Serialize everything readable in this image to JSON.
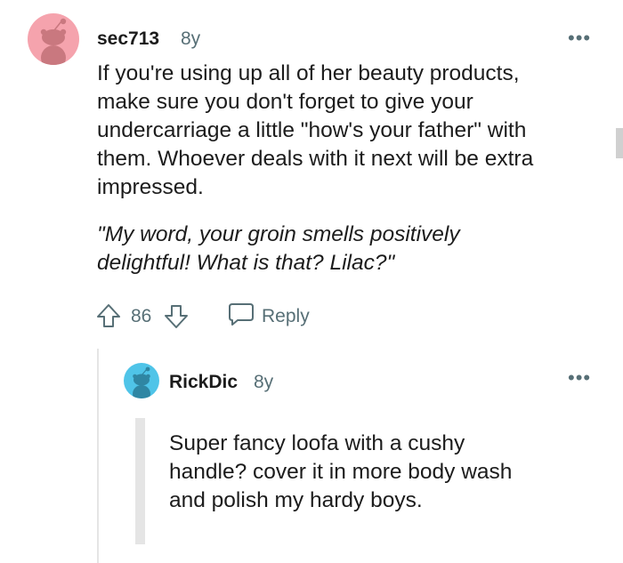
{
  "colors": {
    "avatar_1_bg": "#f5a3ad",
    "avatar_2_bg": "#4fc4e8",
    "meta_text": "#576f76",
    "thread_line": "#e5e5e5"
  },
  "comment": {
    "username": "sec713",
    "age": "8y",
    "more": "•••",
    "body_lines": [
      "If you're using up all of her beauty products,",
      "make sure you don't forget to give your",
      "undercarriage a little \"how's your father\" with",
      "them. Whoever deals with it next will be extra",
      "impressed."
    ],
    "quote_lines": [
      "\"My word, your groin smells positively",
      "delightful! What is that? Lilac?\""
    ],
    "votes": "86",
    "reply_label": "Reply"
  },
  "reply": {
    "username": "RickDic",
    "age": "8y",
    "more": "•••",
    "body_lines": [
      "Super fancy loofa with a cushy",
      "handle? cover it in more body wash",
      "and polish my hardy boys."
    ]
  }
}
